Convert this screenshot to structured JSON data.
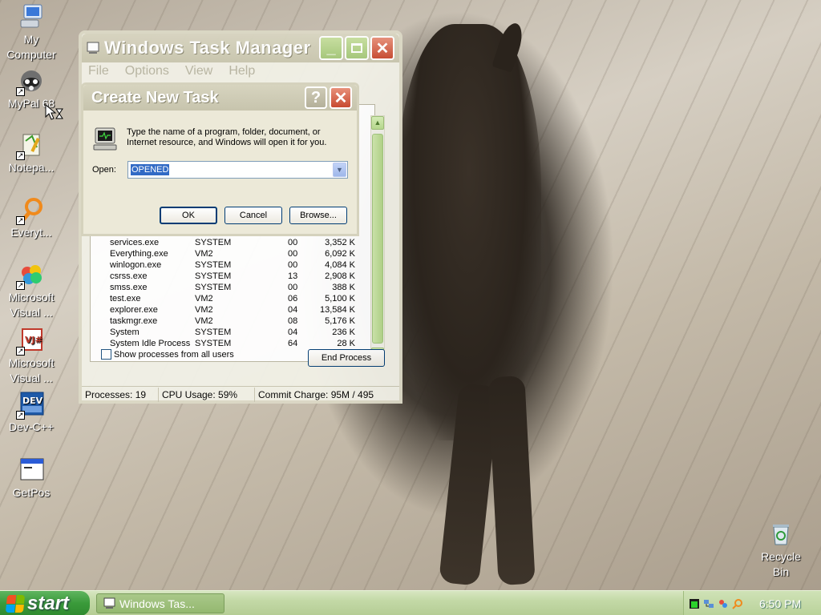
{
  "desktop": {
    "icons": [
      {
        "label_lines": [
          "My",
          "Computer"
        ]
      },
      {
        "label_lines": [
          "MyPal 68"
        ]
      },
      {
        "label_lines": [
          "Notepa..."
        ]
      },
      {
        "label_lines": [
          "Everyt..."
        ]
      },
      {
        "label_lines": [
          "Microsoft",
          "Visual ..."
        ]
      },
      {
        "label_lines": [
          "Microsoft",
          "Visual ..."
        ]
      },
      {
        "label_lines": [
          "Dev-C++"
        ]
      },
      {
        "label_lines": [
          "GetPos"
        ]
      },
      {
        "label_lines": [
          "Recycle",
          "Bin"
        ]
      }
    ]
  },
  "task_manager": {
    "title": "Windows Task Manager",
    "menu": [
      "File",
      "Options",
      "View",
      "Help"
    ],
    "processes": [
      {
        "name": "services.exe",
        "user": "SYSTEM",
        "cpu": "00",
        "mem": "3,352 K"
      },
      {
        "name": "Everything.exe",
        "user": "VM2",
        "cpu": "00",
        "mem": "6,092 K"
      },
      {
        "name": "winlogon.exe",
        "user": "SYSTEM",
        "cpu": "00",
        "mem": "4,084 K"
      },
      {
        "name": "csrss.exe",
        "user": "SYSTEM",
        "cpu": "13",
        "mem": "2,908 K"
      },
      {
        "name": "smss.exe",
        "user": "SYSTEM",
        "cpu": "00",
        "mem": "388 K"
      },
      {
        "name": "test.exe",
        "user": "VM2",
        "cpu": "06",
        "mem": "5,100 K"
      },
      {
        "name": "explorer.exe",
        "user": "VM2",
        "cpu": "04",
        "mem": "13,584 K"
      },
      {
        "name": "taskmgr.exe",
        "user": "VM2",
        "cpu": "08",
        "mem": "5,176 K"
      },
      {
        "name": "System",
        "user": "SYSTEM",
        "cpu": "04",
        "mem": "236 K"
      },
      {
        "name": "System Idle Process",
        "user": "SYSTEM",
        "cpu": "64",
        "mem": "28 K"
      }
    ],
    "show_all_label": "Show processes from all users",
    "end_process_label": "End Process",
    "status": {
      "processes": "Processes: 19",
      "cpu": "CPU Usage: 59%",
      "commit": "Commit Charge: 95M / 495"
    }
  },
  "run_dialog": {
    "title": "Create New Task",
    "help_glyph": "?",
    "description": "Type the name of a program, folder, document, or Internet resource, and Windows will open it for you.",
    "open_label": "Open:",
    "open_value": "OPENED",
    "ok_label": "OK",
    "cancel_label": "Cancel",
    "browse_label": "Browse..."
  },
  "taskbar": {
    "start_label": "start",
    "task_button": "Windows Tas...",
    "clock": "6:50 PM"
  }
}
